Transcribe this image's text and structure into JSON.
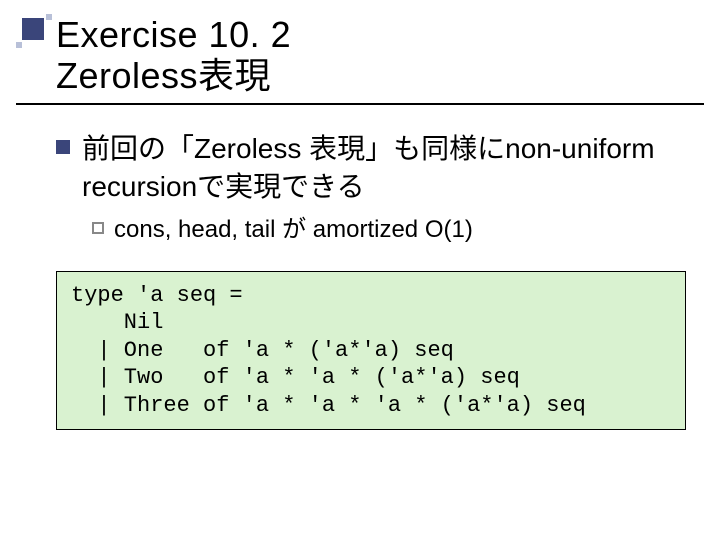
{
  "title": {
    "line1": "Exercise 10. 2",
    "line2": "Zeroless表現"
  },
  "bullet": "前回の「Zeroless 表現」も同様にnon-uniform recursionで実現できる",
  "subbullet": "cons,  head, tail が amortized O(1)",
  "code": "type 'a seq =\n    Nil\n  | One   of 'a * ('a*'a) seq\n  | Two   of 'a * 'a * ('a*'a) seq\n  | Three of 'a * 'a * 'a * ('a*'a) seq"
}
